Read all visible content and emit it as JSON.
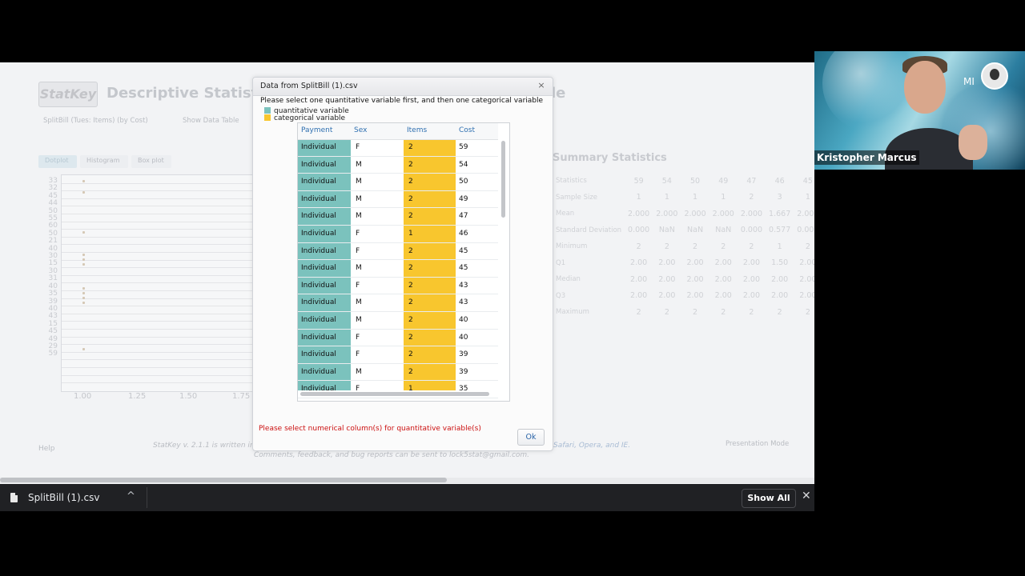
{
  "app": {
    "logo": "StatKey",
    "title": "Descriptive Statistics f",
    "title_tail": "le",
    "dataset_tab": "SplitBill (Tues: Items) (by Cost)",
    "show_table": "Show Data Table",
    "tabs": [
      "Dotplot",
      "Histogram",
      "Box plot"
    ],
    "y_ticks": [
      "33",
      "32",
      "45",
      "44",
      "50",
      "55",
      "60",
      "50",
      "21",
      "40",
      "30",
      "15",
      "30",
      "31",
      "40",
      "35",
      "39",
      "40",
      "43",
      "15",
      "45",
      "49",
      "29",
      "59"
    ],
    "x_ticks": [
      "1.00",
      "1.25",
      "1.50",
      "1.75"
    ],
    "summary_title": "Summary Statistics",
    "summary": {
      "header": [
        "Statistics",
        "59",
        "54",
        "50",
        "49",
        "47",
        "46",
        "45",
        "43"
      ],
      "rows": [
        [
          "Sample Size",
          "1",
          "1",
          "1",
          "1",
          "2",
          "3",
          "1",
          "4"
        ],
        [
          "Mean",
          "2.000",
          "2.000",
          "2.000",
          "2.000",
          "2.000",
          "1.667",
          "2.000",
          "2"
        ],
        [
          "Standard Deviation",
          "0.000",
          "NaN",
          "NaN",
          "NaN",
          "0.000",
          "0.577",
          "0.000",
          "0."
        ],
        [
          "Minimum",
          "2",
          "2",
          "2",
          "2",
          "2",
          "1",
          "2",
          ""
        ],
        [
          "Q1",
          "2.00",
          "2.00",
          "2.00",
          "2.00",
          "2.00",
          "1.50",
          "2.00",
          "2"
        ],
        [
          "Median",
          "2.00",
          "2.00",
          "2.00",
          "2.00",
          "2.00",
          "2.00",
          "2.00",
          "2"
        ],
        [
          "Q3",
          "2.00",
          "2.00",
          "2.00",
          "2.00",
          "2.00",
          "2.00",
          "2.00",
          "2"
        ],
        [
          "Maximum",
          "2",
          "2",
          "2",
          "2",
          "2",
          "2",
          "2",
          ""
        ]
      ]
    },
    "help": "Help",
    "footer1": "StatKey v. 2.1.1 is written in",
    "footer_browsers": "Safari, Opera, and IE.",
    "footer2": "Comments, feedback, and bug reports can be sent to lock5stat@gmail.com.",
    "presentation_mode": "Presentation Mode"
  },
  "dialog": {
    "title": "Data from SplitBill (1).csv",
    "instruction": "Please select one quantitative variable first, and then one categorical variable",
    "legend": [
      {
        "label": "quantitative variable",
        "color": "#7bc2bd"
      },
      {
        "label": "categorical variable",
        "color": "#f8c62e"
      }
    ],
    "columns": [
      "Payment",
      "Sex",
      "Items",
      "Cost"
    ],
    "rows": [
      [
        "Individual",
        "F",
        "2",
        "59"
      ],
      [
        "Individual",
        "M",
        "2",
        "54"
      ],
      [
        "Individual",
        "M",
        "2",
        "50"
      ],
      [
        "Individual",
        "M",
        "2",
        "49"
      ],
      [
        "Individual",
        "M",
        "2",
        "47"
      ],
      [
        "Individual",
        "F",
        "1",
        "46"
      ],
      [
        "Individual",
        "F",
        "2",
        "45"
      ],
      [
        "Individual",
        "M",
        "2",
        "45"
      ],
      [
        "Individual",
        "F",
        "2",
        "43"
      ],
      [
        "Individual",
        "M",
        "2",
        "43"
      ],
      [
        "Individual",
        "M",
        "2",
        "40"
      ],
      [
        "Individual",
        "F",
        "2",
        "40"
      ],
      [
        "Individual",
        "F",
        "2",
        "39"
      ],
      [
        "Individual",
        "M",
        "2",
        "39"
      ],
      [
        "Individual",
        "F",
        "1",
        "35"
      ]
    ],
    "error": "Please select numerical column(s) for quantitative variable(s)",
    "ok": "Ok",
    "close": "×"
  },
  "webcam": {
    "name": "Kristopher Marcus",
    "initials": "MI"
  },
  "download_bar": {
    "file": "SplitBill (1).csv",
    "chevron": "^",
    "show_all": "Show All",
    "close": "✕"
  }
}
